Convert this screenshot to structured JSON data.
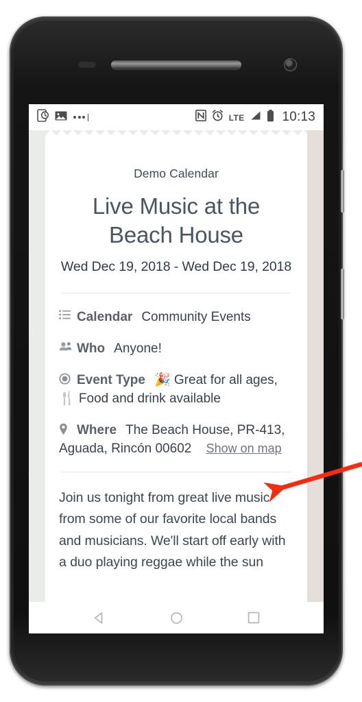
{
  "statusbar": {
    "icons_left": [
      "screen-timer-icon",
      "image-icon",
      "more-notifications-icon"
    ],
    "icons_right": [
      "nfc-icon",
      "alarm-icon",
      "signal-icon",
      "battery-icon"
    ],
    "network_label": "LTE",
    "clock": "10:13"
  },
  "event": {
    "calendar_name": "Demo Calendar",
    "title": "Live Music at the Beach House",
    "dates": "Wed Dec 19, 2018 - Wed Dec 19, 2018",
    "details": [
      {
        "icon": "list-icon",
        "label": "Calendar",
        "value": "Community Events"
      },
      {
        "icon": "people-icon",
        "label": "Who",
        "value": "Anyone!"
      },
      {
        "icon": "circle-dot-icon",
        "label": "Event Type",
        "value_line1": "🎉 Great for all ages,",
        "value_line2": "🍴 Food and drink available"
      },
      {
        "icon": "map-pin-icon",
        "label": "Where",
        "value_line1": "The Beach House, PR-413,",
        "value_line2": "Aguada, Rincón 00602",
        "link_label": "Show on map"
      }
    ],
    "description": "Join us tonight from great live music from some of our favorite local bands and musicians. We'll start off early with a duo playing reggae while the sun"
  },
  "navbar": {
    "back": "back-button",
    "home": "home-button",
    "recents": "recents-button"
  },
  "annotation": {
    "arrow_color": "#F42D10",
    "points_at": "Show on map"
  },
  "colors": {
    "page_background": "#E9ECE9",
    "page_background_right": "#E5DEDB",
    "card": "#FFFFFF",
    "title_text": "#4A5560",
    "body_text": "#39424C",
    "divider": "#E4E4E4",
    "phone_body": "#1B1B1B"
  }
}
